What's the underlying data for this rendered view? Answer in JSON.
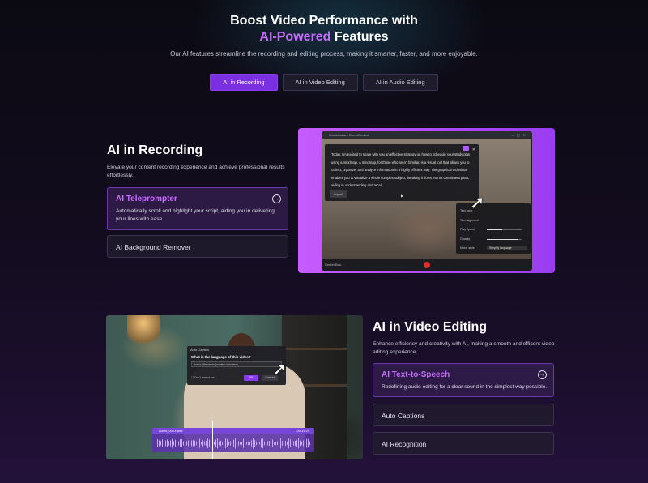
{
  "hero": {
    "title_line1": "Boost Video Performance with",
    "title_accent": "AI-Powered",
    "title_line2_rest": " Features",
    "subtitle": "Our AI features streamline the recording and editing process, making it smarter, faster, and more enjoyable."
  },
  "tabs": [
    {
      "label": "AI in Recording",
      "active": true
    },
    {
      "label": "AI in Video Editing",
      "active": false
    },
    {
      "label": "AI in Audio Editing",
      "active": false
    }
  ],
  "recording": {
    "title": "AI in Recording",
    "desc": "Elevate your content recording experience and achieve professional results effortlessly.",
    "cards": [
      {
        "title": "AI Teleprompter",
        "desc": "Automatically scroll and highlight your script, aiding you in delivering your lines with ease.",
        "active": true
      },
      {
        "title": "AI Background Remover",
        "active": false
      }
    ],
    "app": {
      "window_title": "Wondershare DemoCreator",
      "prompter_text": "Today, I'm excited to share with you an effective strategy on how to schedule your study plan using a mindmap. A mindmap, for those who aren't familiar, is a visual tool that allows you to collect, organize, and analyze information in a highly efficient way. The graphical technique enables you to visualize a whole complex subject, breaking it down into its constituent parts, aiding in understanding and recall.",
      "import_label": "Import",
      "settings": [
        {
          "label": "Text color"
        },
        {
          "label": "Text alignment"
        },
        {
          "label": "Play Speed",
          "level": 0.45
        },
        {
          "label": "Opacity",
          "level": 0.9
        },
        {
          "label": "Mirror style",
          "value": "Simplify language"
        }
      ],
      "camera_label": "Center Bou..."
    }
  },
  "editing": {
    "title": "AI in Video Editing",
    "desc": "Enhance efficiency and creativity with AI, making a smooth and efficent video editing experience.",
    "cards": [
      {
        "title": "AI Text-to-Speech",
        "desc": "Redefining audio editing for a clear sound in the simplest way possible.",
        "active": true
      },
      {
        "title": "Auto Captions",
        "active": false
      },
      {
        "title": "AI Recognition",
        "active": false
      }
    ],
    "dialog": {
      "title": "Auto Caption",
      "question": "What is the language of this video?",
      "select_value": "Arabic (Mandarin (modern standard)",
      "checkbox_label": "Don't remind me",
      "ok_label": "OK",
      "cancel_label": "Cancel"
    },
    "audio": {
      "file_name": "Audio_0023.wav",
      "time": "00:13:24"
    }
  },
  "colors": {
    "accent": "#c86cff",
    "tab_active": "#7a2fe0",
    "record": "#e02d2d"
  }
}
